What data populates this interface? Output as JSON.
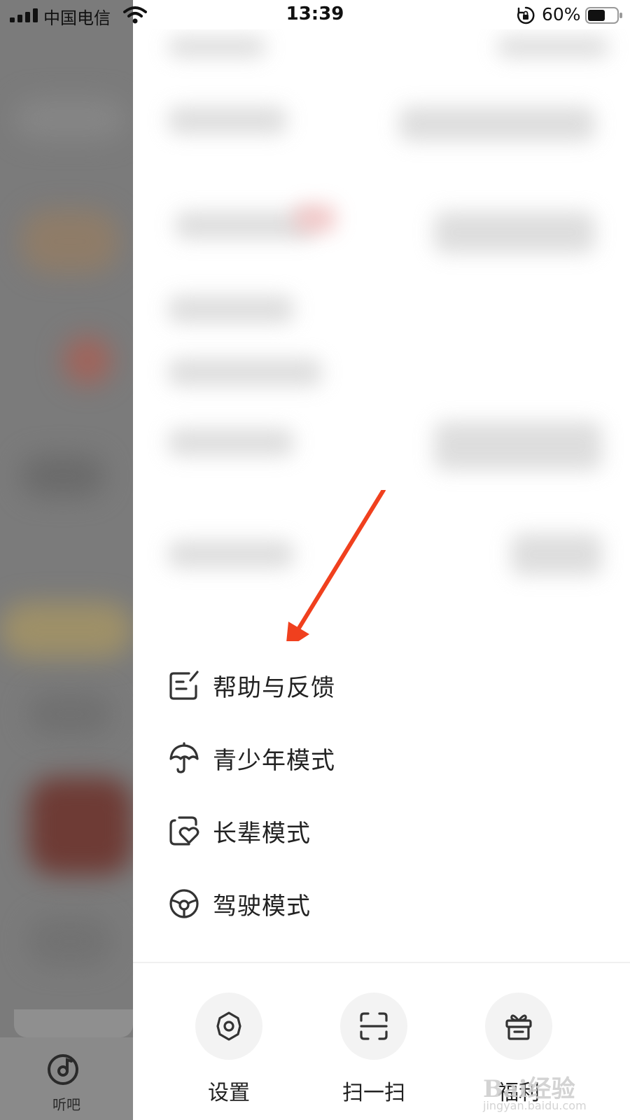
{
  "status_bar": {
    "carrier": "中国电信",
    "time": "13:39",
    "battery_percent": "60%",
    "battery_level": 0.6,
    "icons": [
      "signal-icon",
      "wifi-icon",
      "rotation-lock-icon",
      "battery-icon"
    ]
  },
  "menu": {
    "items": [
      {
        "label": "帮助与反馈",
        "icon": "feedback-icon"
      },
      {
        "label": "青少年模式",
        "icon": "umbrella-icon"
      },
      {
        "label": "长辈模式",
        "icon": "heart-photo-icon"
      },
      {
        "label": "驾驶模式",
        "icon": "steering-wheel-icon"
      }
    ]
  },
  "actions": [
    {
      "label": "设置",
      "icon": "gear-icon"
    },
    {
      "label": "扫一扫",
      "icon": "scan-icon"
    },
    {
      "label": "福利",
      "icon": "gift-icon"
    }
  ],
  "bottom_nav": {
    "listen_label": "听吧",
    "icon": "music-disc-icon"
  },
  "watermark": {
    "brand": "Bai经验",
    "url": "jingyan.baidu.com"
  },
  "colors": {
    "annotation_arrow": "#f0401e",
    "overlay": "#7b7b7b",
    "menu_text": "#222222",
    "action_bg": "#f3f3f3"
  }
}
